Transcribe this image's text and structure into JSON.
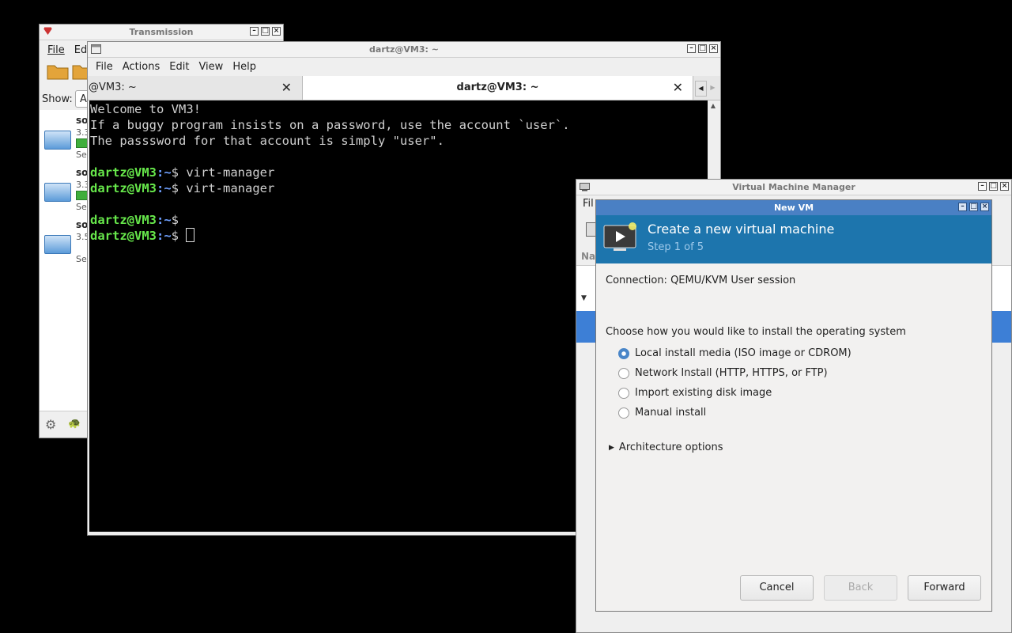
{
  "transmission": {
    "title": "Transmission",
    "menu": [
      "File",
      "Ed"
    ],
    "show_label": "Show:",
    "show_value": "A",
    "torrents": [
      {
        "name": "sol",
        "size": "3.3",
        "status": "See"
      },
      {
        "name": "sol",
        "size": "3.3",
        "status": "See"
      },
      {
        "name": "sol",
        "size": "3.5",
        "status": "See"
      }
    ]
  },
  "terminal": {
    "title": "dartz@VM3: ~",
    "menu": [
      "File",
      "Actions",
      "Edit",
      "View",
      "Help"
    ],
    "tabs": [
      {
        "label": "@VM3: ~"
      },
      {
        "label": "dartz@VM3: ~"
      }
    ],
    "welcome_lines": [
      "Welcome to VM3!",
      "If a buggy program insists on a password, use the account `user`.",
      "The passsword for that account is simply \"user\"."
    ],
    "prompt_user": "dartz@VM3",
    "prompt_path": ":~",
    "prompt_symbol": "$ ",
    "commands": [
      "virt-manager",
      "virt-manager",
      "",
      ""
    ]
  },
  "vmm": {
    "title": "Virtual Machine Manager",
    "menu_partial": "Fil",
    "column_partial": "Na"
  },
  "newvm": {
    "title": "New VM",
    "heading": "Create a new virtual machine",
    "step": "Step 1 of 5",
    "connection": "Connection:  QEMU/KVM User session",
    "prompt": "Choose how you would like to install the operating system",
    "options": [
      {
        "label": "Local install media (ISO image or CDROM)",
        "selected": true
      },
      {
        "label": "Network Install (HTTP, HTTPS, or FTP)",
        "selected": false
      },
      {
        "label": "Import existing disk image",
        "selected": false
      },
      {
        "label": "Manual install",
        "selected": false
      }
    ],
    "expander": "Architecture options",
    "buttons": {
      "cancel": "Cancel",
      "back": "Back",
      "forward": "Forward"
    }
  }
}
